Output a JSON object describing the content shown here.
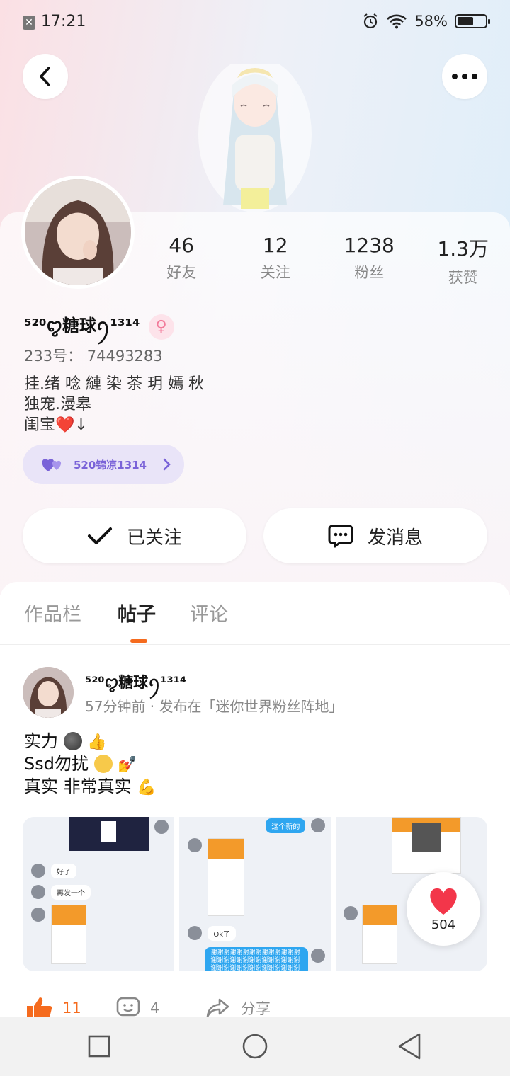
{
  "status_bar": {
    "time": "17:21",
    "battery": "58%",
    "battery_level": 0.58
  },
  "profile": {
    "stats": [
      {
        "value": "46",
        "label": "好友"
      },
      {
        "value": "12",
        "label": "关注"
      },
      {
        "value": "1238",
        "label": "粉丝"
      },
      {
        "value": "1.3万",
        "label": "获赞"
      }
    ],
    "nickname": "⁵²⁰ꨄ糖球ꪆ¹³¹⁴",
    "gender_symbol": "♀",
    "uid": "233号：  74493283",
    "bio_lines": [
      "挂.绪 唸 縺 染 茶 玥 嫣 秋",
      "独宠.漫皋",
      "闺宝❤️↓"
    ],
    "partner_tag": "520锦凉1314",
    "follow_button": "已关注",
    "message_button": "发消息"
  },
  "tabs": [
    {
      "label": "作品栏",
      "active": false
    },
    {
      "label": "帖子",
      "active": true
    },
    {
      "label": "评论",
      "active": false
    }
  ],
  "post": {
    "author": "⁵²⁰ꨄ糖球ꪆ¹³¹⁴",
    "meta": "57分钟前 · 发布在「迷你世界粉丝阵地」",
    "lines": [
      "实力",
      "Ssd勿扰",
      "真实 非常真实"
    ],
    "images": [
      {
        "bubbles": [
          "好了",
          "再发一个"
        ]
      },
      {
        "bubbles": [
          "这个新的",
          "Ok了",
          "谢谢谢谢谢谢谢谢谢谢谢谢谢谢谢谢谢谢谢谢谢谢谢谢谢谢谢谢谢谢谢谢谢谢谢谢谢谢谢谢谢谢谢谢谢谢谢"
        ]
      },
      {
        "bubbles": []
      }
    ],
    "heart_count": "504",
    "like_count": "11",
    "comment_count": "4",
    "share_label": "分享"
  },
  "colors": {
    "accent": "#f56b1e",
    "purple": "#7a63d8",
    "pink": "#f27a9a"
  },
  "icons": [
    "back-icon",
    "more-icon",
    "check-icon",
    "chat-icon",
    "chevron-right-icon",
    "hearts-icon",
    "heart-icon",
    "like-icon",
    "comment-icon",
    "share-icon",
    "nav-recents-icon",
    "nav-home-icon",
    "nav-back-icon"
  ]
}
